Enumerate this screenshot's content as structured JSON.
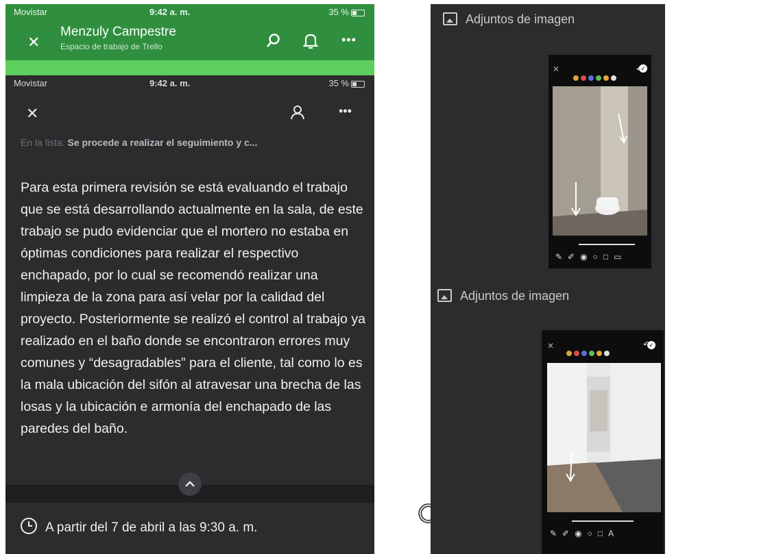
{
  "status_bar": {
    "carrier": "Movistar",
    "time": "9:42 a. m.",
    "battery": "35 %"
  },
  "board_header": {
    "title": "Menzuly Campestre",
    "subtitle": "Espacio de trabajo de Trello"
  },
  "card": {
    "list_prefix": "En la lista:",
    "list_name": "Se procede a realizar el seguimiento y c...",
    "description": "Para esta primera revisión se está evaluando el trabajo que se está desarrollando actualmente en la sala, de este trabajo se pudo evidenciar que el mortero no estaba en óptimas condiciones para realizar el respectivo enchapado, por lo cual se recomendó realizar una limpieza de la zona para así velar por la calidad del proyecto. Posteriormente se realizó el control al trabajo ya realizado en el baño donde se encontraron errores muy comunes y “desagradables” para el cliente, tal como lo es la mala ubicación del sifón al atravesar una brecha de las losas y la ubicación e armonía del enchapado de las paredes del baño.",
    "due": "A partir del 7 de abril a las 9:30 a. m."
  },
  "attachments": [
    {
      "label": "Adjuntos de imagen"
    },
    {
      "label": "Adjuntos de imagen"
    }
  ],
  "colors": {
    "trello_green": "#2f8f3e",
    "dark_bg": "#2b2c2e"
  }
}
